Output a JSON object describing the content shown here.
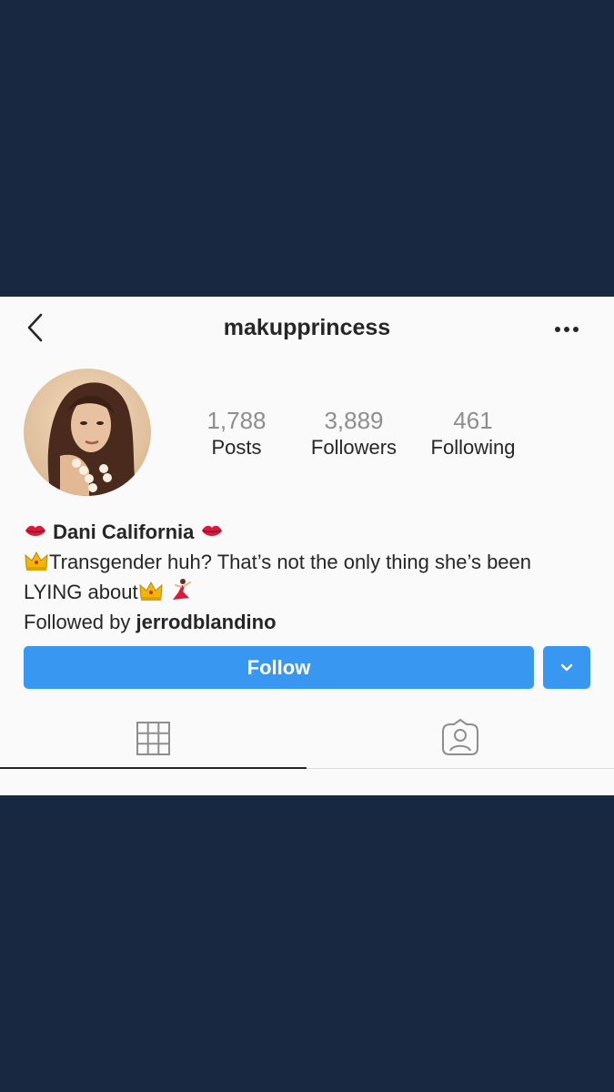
{
  "colors": {
    "outer_background": "#172840",
    "card_background": "#fafafa",
    "accent": "#3897f0",
    "text_primary": "#262626",
    "text_muted": "#8e8e8e"
  },
  "header": {
    "username": "makupprincess",
    "back_icon": "chevron-left-icon",
    "more_icon": "more-horizontal-icon"
  },
  "stats": [
    {
      "value": "1,788",
      "label": "Posts"
    },
    {
      "value": "3,889",
      "label": "Followers"
    },
    {
      "value": "461",
      "label": "Following"
    }
  ],
  "bio": {
    "display_name": "Dani California",
    "line1": "Transgender huh? That’s not the only thing she’s been",
    "line2": "LYING about",
    "followed_by_prefix": "Followed by ",
    "followed_by_user": "jerrodblandino",
    "emojis": [
      "kiss-mark-icon",
      "crown-icon",
      "dancer-icon"
    ]
  },
  "actions": {
    "follow_label": "Follow",
    "dropdown_icon": "chevron-down-icon"
  },
  "tabs": [
    {
      "name": "grid",
      "icon": "grid-icon",
      "active": true
    },
    {
      "name": "tagged",
      "icon": "tagged-person-icon",
      "active": false
    }
  ]
}
